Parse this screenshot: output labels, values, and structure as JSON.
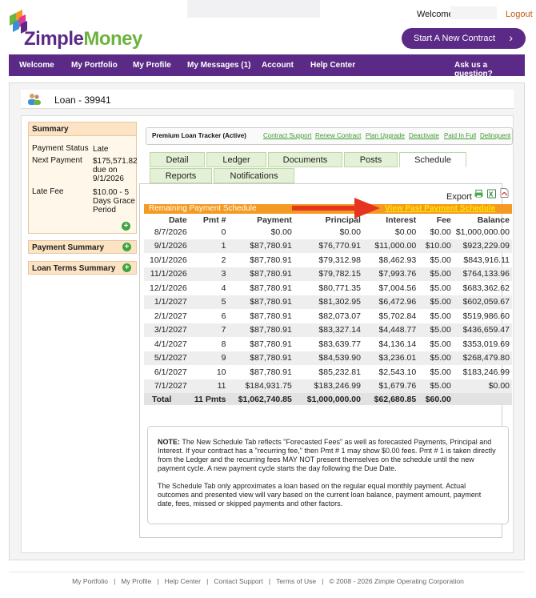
{
  "header": {
    "logo": "ZimpleMoney",
    "logo_part1": "Zimple",
    "logo_part2": "Money",
    "welcome": "Welcome,",
    "logout": "Logout",
    "start_button": "Start A New Contract",
    "start_chevron": "›"
  },
  "nav": {
    "items": [
      "Welcome",
      "My Portfolio",
      "My Profile",
      "My Messages (1)",
      "Account",
      "Help Center"
    ],
    "ask": "Ask us a question?"
  },
  "loan": {
    "title": "Loan - 39941"
  },
  "summary": {
    "heading": "Summary",
    "status_label": "Payment Status",
    "status_value": "Late",
    "next_label": "Next Payment",
    "next_value_1": "$175,571.82",
    "next_value_2": "due on",
    "next_value_3": "9/1/2026",
    "late_fee_label": "Late Fee",
    "late_fee_1": "$10.00 - 5",
    "late_fee_2": "Days Grace",
    "late_fee_3": "Period",
    "plus": "+"
  },
  "sidebar_sections": [
    "Payment Summary",
    "Loan Terms Summary"
  ],
  "tracker": {
    "title": "Premium Loan Tracker (Active)",
    "links": [
      "Contract Support",
      "Renew Contract",
      "Plan Upgrade",
      "Deactivate",
      "Paid In Full",
      "Delinquent"
    ]
  },
  "tabs": {
    "row1": [
      "Detail",
      "Ledger",
      "Documents",
      "Posts",
      "Schedule"
    ],
    "row2": [
      "Reports",
      "Notifications"
    ],
    "active": "Schedule"
  },
  "export_label": "Export",
  "schedule": {
    "title": "Remaining Payment Schedule",
    "past_link": "View Past Payment Schedule",
    "columns": [
      "Date",
      "Pmt #",
      "Payment",
      "Principal",
      "Interest",
      "Fee",
      "Balance"
    ],
    "rows": [
      [
        "8/7/2026",
        "0",
        "$0.00",
        "$0.00",
        "$0.00",
        "$0.00",
        "$1,000,000.00"
      ],
      [
        "9/1/2026",
        "1",
        "$87,780.91",
        "$76,770.91",
        "$11,000.00",
        "$10.00",
        "$923,229.09"
      ],
      [
        "10/1/2026",
        "2",
        "$87,780.91",
        "$79,312.98",
        "$8,462.93",
        "$5.00",
        "$843,916.11"
      ],
      [
        "11/1/2026",
        "3",
        "$87,780.91",
        "$79,782.15",
        "$7,993.76",
        "$5.00",
        "$764,133.96"
      ],
      [
        "12/1/2026",
        "4",
        "$87,780.91",
        "$80,771.35",
        "$7,004.56",
        "$5.00",
        "$683,362.62"
      ],
      [
        "1/1/2027",
        "5",
        "$87,780.91",
        "$81,302.95",
        "$6,472.96",
        "$5.00",
        "$602,059.67"
      ],
      [
        "2/1/2027",
        "6",
        "$87,780.91",
        "$82,073.07",
        "$5,702.84",
        "$5.00",
        "$519,986.60"
      ],
      [
        "3/1/2027",
        "7",
        "$87,780.91",
        "$83,327.14",
        "$4,448.77",
        "$5.00",
        "$436,659.47"
      ],
      [
        "4/1/2027",
        "8",
        "$87,780.91",
        "$83,639.77",
        "$4,136.14",
        "$5.00",
        "$353,019.69"
      ],
      [
        "5/1/2027",
        "9",
        "$87,780.91",
        "$84,539.90",
        "$3,236.01",
        "$5.00",
        "$268,479.80"
      ],
      [
        "6/1/2027",
        "10",
        "$87,780.91",
        "$85,232.81",
        "$2,543.10",
        "$5.00",
        "$183,246.99"
      ],
      [
        "7/1/2027",
        "11",
        "$184,931.75",
        "$183,246.99",
        "$1,679.76",
        "$5.00",
        "$0.00"
      ]
    ],
    "total": [
      "Total",
      "11 Pmts",
      "$1,062,740.85",
      "$1,000,000.00",
      "$62,680.85",
      "$60.00",
      ""
    ]
  },
  "note": {
    "label": "NOTE:",
    "p1": "The New Schedule Tab reflects \"Forecasted Fees\" as well as forecasted Payments, Principal and Interest. If your contract has a \"recurring fee,\" then Pmt # 1 may show $0.00 fees. Pmt # 1 is taken directly from the Ledger and the recurring fees MAY NOT present themselves on the schedule until the new payment cycle. A new payment cycle starts the day following the Due Date.",
    "p2": "The Schedule Tab only approximates a loan based on the regular equal monthly payment. Actual outcomes and presented view will vary based on the current loan balance, payment amount, payment date, fees, missed or skipped payments and other factors."
  },
  "footer": {
    "links": [
      "My Portfolio",
      "My Profile",
      "Help Center",
      "Contact Support",
      "Terms of Use"
    ],
    "separator": "|",
    "copyright": "© 2008 - 2026 Zimple Operating Corporation"
  },
  "colors": {
    "brand_purple": "#5b2a86",
    "brand_green": "#6db33f",
    "schedule_orange": "#f49a22",
    "link_yellow": "#ffe800",
    "arrow_red": "#e53520"
  }
}
